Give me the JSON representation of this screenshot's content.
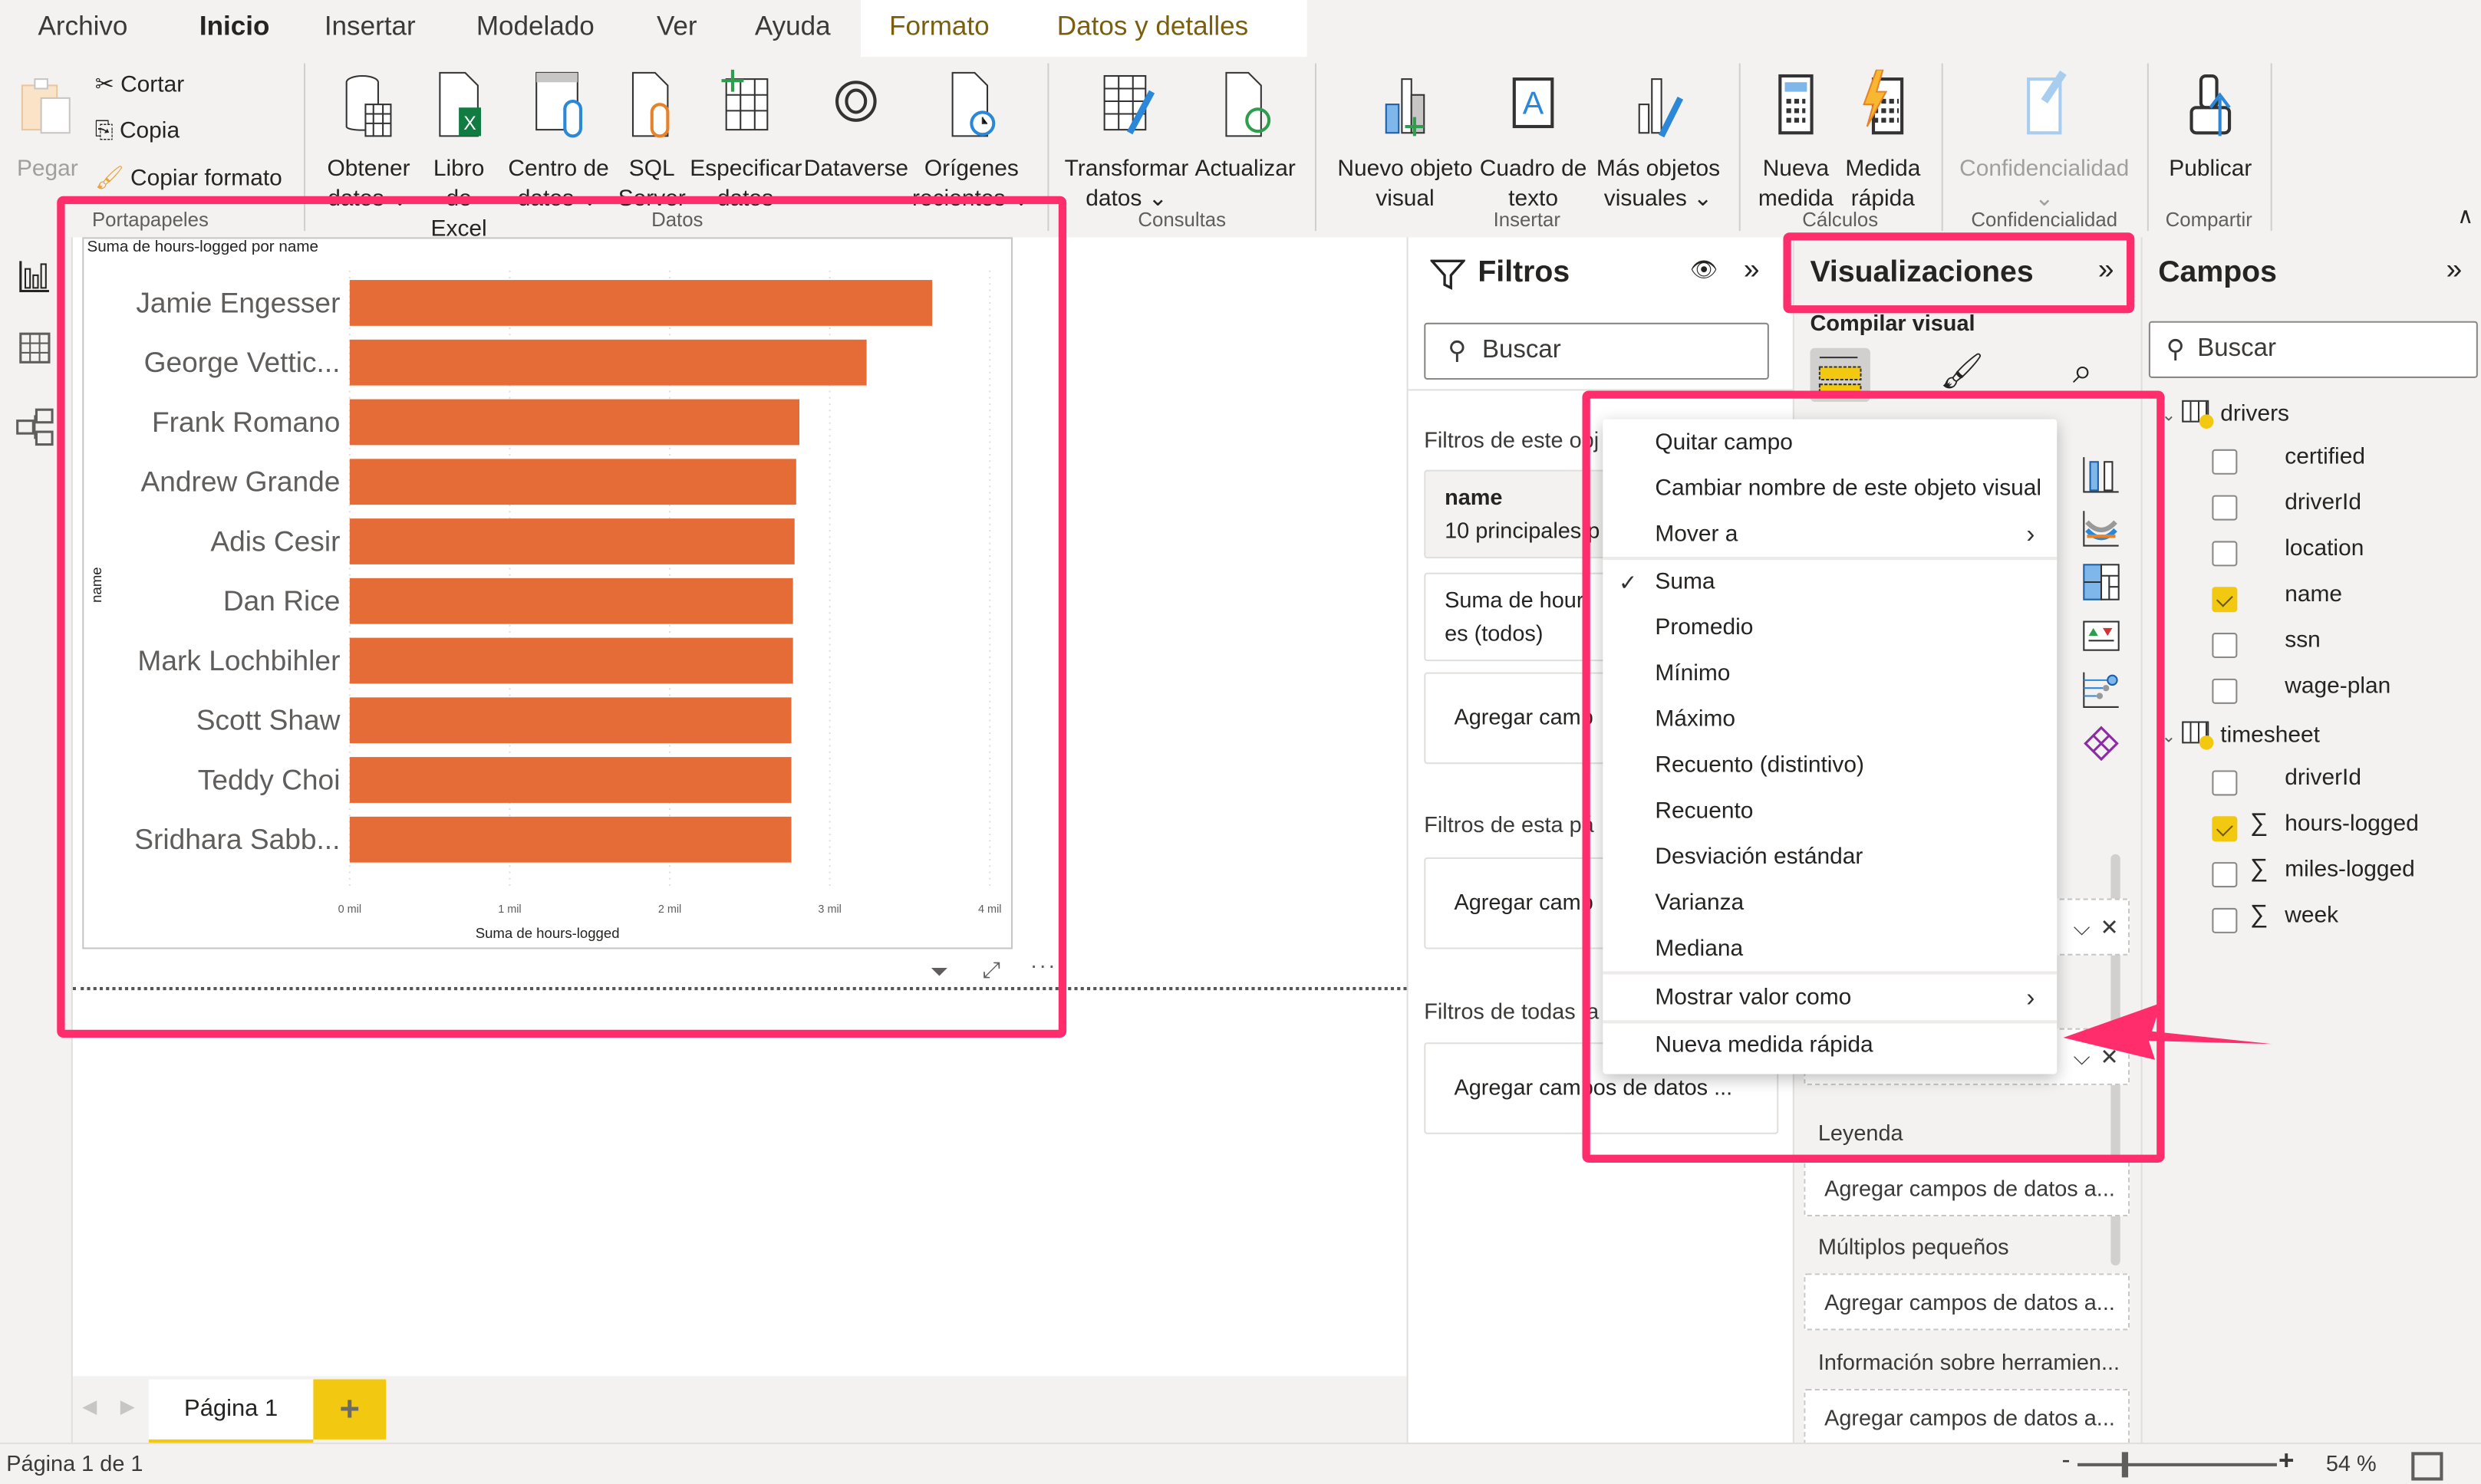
{
  "menu_tabs": [
    "Archivo",
    "Inicio",
    "Insertar",
    "Modelado",
    "Ver",
    "Ayuda",
    "Formato",
    "Datos y detalles"
  ],
  "active_tab": "Inicio",
  "ribbon": {
    "clipboard": {
      "paste": "Pegar",
      "cut": "Cortar",
      "copy": "Copia",
      "format_painter": "Copiar formato",
      "group": "Portapapeles"
    },
    "data": {
      "items": [
        {
          "l1": "Obtener",
          "l2": "datos ⌄"
        },
        {
          "l1": "Libro de",
          "l2": "Excel"
        },
        {
          "l1": "Centro de",
          "l2": "datos ⌄"
        },
        {
          "l1": "SQL",
          "l2": "Server"
        },
        {
          "l1": "Especificar",
          "l2": "datos"
        },
        {
          "l1": "Dataverse",
          "l2": ""
        },
        {
          "l1": "Orígenes",
          "l2": "recientes ⌄"
        }
      ],
      "group": "Datos"
    },
    "queries": {
      "items": [
        {
          "l1": "Transformar",
          "l2": "datos ⌄"
        },
        {
          "l1": "Actualizar",
          "l2": ""
        }
      ],
      "group": "Consultas"
    },
    "insert": {
      "items": [
        {
          "l1": "Nuevo objeto",
          "l2": "visual"
        },
        {
          "l1": "Cuadro de",
          "l2": "texto"
        },
        {
          "l1": "Más objetos",
          "l2": "visuales ⌄"
        }
      ],
      "group": "Insertar"
    },
    "calc": {
      "items": [
        {
          "l1": "Nueva",
          "l2": "medida"
        },
        {
          "l1": "Medida",
          "l2": "rápida"
        }
      ],
      "group": "Cálculos"
    },
    "sensitivity": {
      "l1": "Confidencialidad",
      "l2": "⌄",
      "group": "Confidencialidad"
    },
    "share": {
      "l1": "Publicar",
      "group": "Compartir"
    }
  },
  "chart_data": {
    "type": "bar",
    "orientation": "horizontal",
    "title": "Suma de hours-logged por name",
    "xlabel": "Suma de hours-logged",
    "ylabel": "name",
    "categories": [
      "Jamie Engesser",
      "George Vettic...",
      "Frank Romano",
      "Andrew Grande",
      "Adis Cesir",
      "Dan Rice",
      "Mark Lochbihler",
      "Scott Shaw",
      "Teddy Choi",
      "Sridhara Sabb..."
    ],
    "values": [
      3640,
      3230,
      2810,
      2790,
      2780,
      2770,
      2770,
      2760,
      2760,
      2760
    ],
    "xlim": [
      0,
      4000
    ],
    "xticks": [
      0,
      1000,
      2000,
      3000,
      4000
    ],
    "xtick_labels": [
      "0 mil",
      "1 mil",
      "2 mil",
      "3 mil",
      "4 mil"
    ],
    "bar_color": "#e66c37",
    "grid": true
  },
  "filters": {
    "title": "Filtros",
    "search_placeholder": "Buscar",
    "visual_section": "Filtros de este obj",
    "card1_title": "name",
    "card1_sub": "10 principales p",
    "card2_l1": "Suma de hour",
    "card2_l2": "es (todos)",
    "add_fields": "Agregar camp",
    "page_section": "Filtros de esta pá",
    "all_section": "Filtros de todas la",
    "add_fields_full": "Agregar campos de datos ..."
  },
  "visualizations": {
    "title": "Visualizaciones",
    "build_label": "Compilar visual",
    "wells": [
      {
        "label": "Leyenda",
        "placeholder": "Agregar campos de datos a..."
      },
      {
        "label": "Múltiplos pequeños",
        "placeholder": "Agregar campos de datos a..."
      },
      {
        "label": "Información sobre herramien...",
        "placeholder": "Agregar campos de datos a..."
      }
    ]
  },
  "context_menu": {
    "items": [
      {
        "label": "Quitar campo"
      },
      {
        "label": "Cambiar nombre de este objeto visual"
      },
      {
        "label": "Mover a",
        "submenu": true
      },
      {
        "label": "Suma",
        "checked": true
      },
      {
        "label": "Promedio"
      },
      {
        "label": "Mínimo"
      },
      {
        "label": "Máximo"
      },
      {
        "label": "Recuento (distintivo)"
      },
      {
        "label": "Recuento"
      },
      {
        "label": "Desviación estándar"
      },
      {
        "label": "Varianza"
      },
      {
        "label": "Mediana"
      },
      {
        "label": "Mostrar valor como",
        "submenu": true
      },
      {
        "label": "Nueva medida rápida"
      }
    ]
  },
  "fields": {
    "title": "Campos",
    "search_placeholder": "Buscar",
    "tables": [
      {
        "name": "drivers",
        "fields": [
          {
            "name": "certified",
            "checked": false,
            "sigma": false
          },
          {
            "name": "driverId",
            "checked": false,
            "sigma": false
          },
          {
            "name": "location",
            "checked": false,
            "sigma": false
          },
          {
            "name": "name",
            "checked": true,
            "sigma": false
          },
          {
            "name": "ssn",
            "checked": false,
            "sigma": false
          },
          {
            "name": "wage-plan",
            "checked": false,
            "sigma": false
          }
        ]
      },
      {
        "name": "timesheet",
        "fields": [
          {
            "name": "driverId",
            "checked": false,
            "sigma": false
          },
          {
            "name": "hours-logged",
            "checked": true,
            "sigma": true
          },
          {
            "name": "miles-logged",
            "checked": false,
            "sigma": true
          },
          {
            "name": "week",
            "checked": false,
            "sigma": true
          }
        ]
      }
    ]
  },
  "pages": {
    "tabs": [
      "Página 1"
    ],
    "add": "+"
  },
  "status": {
    "page_info": "Página 1 de 1",
    "zoom": "54 %",
    "zoom_minus": "-",
    "zoom_plus": "+"
  },
  "colors": {
    "accent": "#f2c811",
    "highlight": "#ff2d6b",
    "bar": "#e66c37",
    "context_tab": "#7a5f0f"
  }
}
